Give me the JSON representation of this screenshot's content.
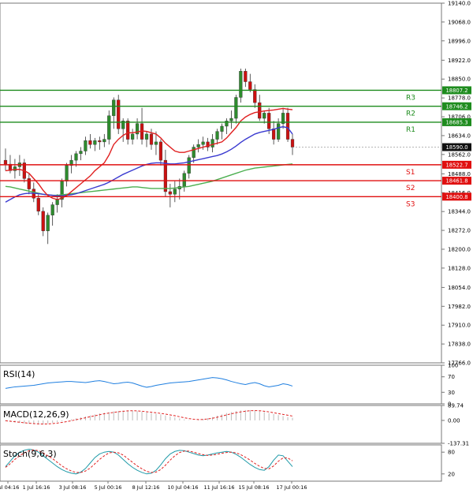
{
  "chart_data": {
    "type": "candlestick",
    "price_axis": {
      "ylim": [
        17766.0,
        19140.0
      ],
      "ticks": [
        "19140.0",
        "19068.0",
        "18996.0",
        "18922.0",
        "18850.0",
        "18778.0",
        "18706.0",
        "18634.0",
        "18562.0",
        "18488.0",
        "18416.0",
        "18344.0",
        "18272.0",
        "18200.0",
        "18128.0",
        "18054.0",
        "17982.0",
        "17910.0",
        "17838.0",
        "17766.0"
      ],
      "ticks_num": [
        19140,
        19068,
        18996,
        18922,
        18850,
        18778,
        18706,
        18634,
        18562,
        18488,
        18416,
        18344,
        18272,
        18200,
        18128,
        18054,
        17982,
        17910,
        17838,
        17766
      ]
    },
    "x_ticks": [
      "Jul 04:16",
      "1 Jul 16:16",
      "3 Jul 08:16",
      "5 Jul 00:16",
      "8 Jul 12:16",
      "10 Jul 04:16",
      "11 Jul 16:16",
      "15 Jul 08:16",
      "17 Jul 00:16"
    ],
    "current_price": "18590.0",
    "levels": [
      {
        "name": "R3",
        "value": 18807.2,
        "label": "18807.2",
        "color": "#1e8c1e"
      },
      {
        "name": "R2",
        "value": 18746.2,
        "label": "18746.2",
        "color": "#1e8c1e"
      },
      {
        "name": "R1",
        "value": 18685.3,
        "label": "18685.3",
        "color": "#1e8c1e"
      },
      {
        "name": "S1",
        "value": 18522.7,
        "label": "18522.7",
        "color": "#e01010"
      },
      {
        "name": "S2",
        "value": 18461.8,
        "label": "18461.8",
        "color": "#e01010"
      },
      {
        "name": "S3",
        "value": 18400.8,
        "label": "18400.8",
        "color": "#e01010"
      }
    ],
    "candles": [
      [
        18540,
        18585,
        18500,
        18525
      ],
      [
        18525,
        18560,
        18490,
        18500
      ],
      [
        18500,
        18545,
        18470,
        18515
      ],
      [
        18515,
        18560,
        18480,
        18530
      ],
      [
        18530,
        18545,
        18455,
        18470
      ],
      [
        18470,
        18490,
        18410,
        18430
      ],
      [
        18430,
        18455,
        18380,
        18395
      ],
      [
        18395,
        18410,
        18330,
        18345
      ],
      [
        18345,
        18360,
        18250,
        18270
      ],
      [
        18270,
        18340,
        18220,
        18330
      ],
      [
        18330,
        18380,
        18290,
        18370
      ],
      [
        18370,
        18410,
        18340,
        18390
      ],
      [
        18390,
        18470,
        18360,
        18460
      ],
      [
        18460,
        18530,
        18440,
        18520
      ],
      [
        18520,
        18560,
        18490,
        18540
      ],
      [
        18540,
        18575,
        18515,
        18565
      ],
      [
        18565,
        18590,
        18540,
        18575
      ],
      [
        18575,
        18630,
        18560,
        18615
      ],
      [
        18615,
        18640,
        18585,
        18600
      ],
      [
        18600,
        18625,
        18575,
        18615
      ],
      [
        18615,
        18630,
        18580,
        18610
      ],
      [
        18610,
        18640,
        18590,
        18620
      ],
      [
        18620,
        18730,
        18600,
        18710
      ],
      [
        18710,
        18780,
        18660,
        18770
      ],
      [
        18770,
        18790,
        18640,
        18660
      ],
      [
        18660,
        18700,
        18610,
        18690
      ],
      [
        18690,
        18700,
        18600,
        18620
      ],
      [
        18620,
        18660,
        18600,
        18640
      ],
      [
        18640,
        18700,
        18620,
        18680
      ],
      [
        18680,
        18740,
        18600,
        18620
      ],
      [
        18620,
        18650,
        18590,
        18640
      ],
      [
        18640,
        18660,
        18580,
        18600
      ],
      [
        18600,
        18650,
        18560,
        18610
      ],
      [
        18610,
        18620,
        18520,
        18540
      ],
      [
        18540,
        18580,
        18400,
        18420
      ],
      [
        18420,
        18450,
        18360,
        18410
      ],
      [
        18410,
        18460,
        18380,
        18430
      ],
      [
        18430,
        18470,
        18390,
        18440
      ],
      [
        18440,
        18500,
        18420,
        18490
      ],
      [
        18490,
        18560,
        18470,
        18550
      ],
      [
        18550,
        18600,
        18530,
        18590
      ],
      [
        18590,
        18620,
        18570,
        18600
      ],
      [
        18600,
        18630,
        18580,
        18610
      ],
      [
        18610,
        18625,
        18575,
        18590
      ],
      [
        18590,
        18640,
        18570,
        18620
      ],
      [
        18620,
        18660,
        18600,
        18650
      ],
      [
        18650,
        18680,
        18620,
        18670
      ],
      [
        18670,
        18700,
        18640,
        18690
      ],
      [
        18690,
        18730,
        18660,
        18700
      ],
      [
        18700,
        18790,
        18680,
        18780
      ],
      [
        18780,
        18890,
        18760,
        18880
      ],
      [
        18880,
        18890,
        18820,
        18840
      ],
      [
        18840,
        18870,
        18800,
        18810
      ],
      [
        18810,
        18830,
        18740,
        18760
      ],
      [
        18760,
        18790,
        18690,
        18700
      ],
      [
        18700,
        18730,
        18680,
        18720
      ],
      [
        18720,
        18740,
        18640,
        18660
      ],
      [
        18660,
        18690,
        18600,
        18620
      ],
      [
        18620,
        18700,
        18610,
        18680
      ],
      [
        18680,
        18740,
        18660,
        18720
      ],
      [
        18720,
        18740,
        18610,
        18620
      ],
      [
        18620,
        18640,
        18560,
        18590
      ]
    ],
    "ma_red": [
      18500,
      18502,
      18505,
      18505,
      18500,
      18490,
      18470,
      18450,
      18425,
      18405,
      18395,
      18390,
      18395,
      18405,
      18420,
      18435,
      18450,
      18465,
      18480,
      18500,
      18515,
      18530,
      18560,
      18600,
      18620,
      18635,
      18645,
      18645,
      18648,
      18652,
      18650,
      18645,
      18640,
      18625,
      18605,
      18590,
      18575,
      18570,
      18570,
      18575,
      18580,
      18585,
      18590,
      18595,
      18600,
      18605,
      18610,
      18625,
      18645,
      18665,
      18690,
      18705,
      18715,
      18722,
      18725,
      18728,
      18730,
      18732,
      18735,
      18738,
      18735,
      18733
    ],
    "ma_blue": [
      18380,
      18390,
      18400,
      18408,
      18412,
      18414,
      18414,
      18412,
      18410,
      18408,
      18406,
      18404,
      18404,
      18406,
      18408,
      18412,
      18418,
      18424,
      18430,
      18436,
      18442,
      18448,
      18456,
      18466,
      18476,
      18486,
      18494,
      18502,
      18510,
      18518,
      18524,
      18528,
      18530,
      18530,
      18528,
      18526,
      18526,
      18528,
      18530,
      18534,
      18538,
      18542,
      18546,
      18550,
      18554,
      18558,
      18564,
      18572,
      18582,
      18594,
      18608,
      18620,
      18630,
      18640,
      18646,
      18650,
      18654,
      18658,
      18664,
      18668,
      18664,
      18640
    ],
    "ma_green": [
      18440,
      18438,
      18434,
      18430,
      18426,
      18422,
      18418,
      18414,
      18410,
      18408,
      18406,
      18406,
      18408,
      18410,
      18412,
      18414,
      18416,
      18418,
      18420,
      18422,
      18424,
      18426,
      18428,
      18430,
      18432,
      18434,
      18436,
      18438,
      18438,
      18436,
      18434,
      18432,
      18432,
      18432,
      18432,
      18432,
      18434,
      18436,
      18438,
      18440,
      18444,
      18448,
      18452,
      18456,
      18460,
      18466,
      18472,
      18478,
      18484,
      18490,
      18496,
      18502,
      18506,
      18510,
      18512,
      18514,
      18516,
      18518,
      18520,
      18522,
      18524,
      18526
    ],
    "rsi": {
      "label": "RSI(14)",
      "ticks": [
        "100",
        "70",
        "30",
        "0"
      ],
      "ticks_num": [
        100,
        70,
        30,
        0
      ],
      "values": [
        40,
        42,
        44,
        45,
        46,
        47,
        48,
        50,
        52,
        54,
        55,
        56,
        57,
        58,
        58,
        57,
        56,
        55,
        57,
        59,
        60,
        58,
        55,
        52,
        53,
        55,
        56,
        54,
        50,
        46,
        43,
        45,
        48,
        50,
        52,
        54,
        55,
        56,
        57,
        58,
        60,
        62,
        64,
        66,
        68,
        67,
        65,
        62,
        58,
        55,
        52,
        50,
        53,
        55,
        52,
        47,
        44,
        46,
        48,
        52,
        50,
        46
      ]
    },
    "macd": {
      "label": "MACD(12,26,9)",
      "ticks": [
        "89.74",
        "0.00",
        "-137.31"
      ],
      "ticks_num": [
        89.74,
        0,
        -137.31
      ],
      "hist": [
        -5,
        -8,
        -12,
        -15,
        -18,
        -20,
        -22,
        -24,
        -22,
        -18,
        -14,
        -10,
        -5,
        0,
        6,
        12,
        18,
        24,
        30,
        36,
        42,
        46,
        50,
        54,
        56,
        58,
        60,
        58,
        55,
        52,
        48,
        44,
        40,
        36,
        30,
        24,
        18,
        12,
        6,
        2,
        0,
        4,
        8,
        14,
        20,
        28,
        36,
        44,
        50,
        56,
        60,
        62,
        62,
        60,
        56,
        50,
        44,
        38,
        32,
        26,
        20,
        16
      ],
      "signal": [
        -2,
        -5,
        -8,
        -11,
        -14,
        -17,
        -19,
        -21,
        -22,
        -21,
        -19,
        -16,
        -12,
        -7,
        -2,
        4,
        10,
        16,
        22,
        28,
        34,
        40,
        44,
        48,
        52,
        55,
        57,
        58,
        57,
        55,
        52,
        49,
        46,
        42,
        38,
        33,
        28,
        22,
        16,
        11,
        7,
        5,
        6,
        9,
        13,
        19,
        26,
        33,
        40,
        46,
        51,
        55,
        58,
        59,
        58,
        55,
        51,
        46,
        41,
        36,
        31,
        26
      ]
    },
    "stoch": {
      "label": "Stoch(9,6,3)",
      "ticks": [
        "80",
        "20"
      ],
      "ticks_num": [
        80,
        20
      ],
      "k": [
        40,
        55,
        70,
        80,
        85,
        88,
        86,
        80,
        70,
        60,
        50,
        40,
        32,
        26,
        22,
        20,
        25,
        35,
        50,
        65,
        75,
        80,
        82,
        80,
        72,
        60,
        48,
        38,
        30,
        24,
        20,
        22,
        30,
        45,
        62,
        75,
        82,
        85,
        84,
        80,
        76,
        72,
        70,
        72,
        75,
        78,
        80,
        82,
        80,
        74,
        66,
        56,
        46,
        38,
        32,
        30,
        40,
        58,
        72,
        70,
        55,
        40
      ],
      "d": [
        38,
        48,
        60,
        70,
        78,
        84,
        86,
        84,
        78,
        70,
        62,
        52,
        42,
        34,
        28,
        24,
        24,
        28,
        36,
        48,
        60,
        70,
        78,
        80,
        78,
        72,
        62,
        52,
        42,
        34,
        27,
        24,
        25,
        32,
        44,
        58,
        70,
        79,
        83,
        83,
        80,
        76,
        73,
        71,
        72,
        74,
        77,
        79,
        80,
        78,
        73,
        66,
        58,
        49,
        41,
        35,
        34,
        42,
        55,
        64,
        64,
        56
      ]
    }
  }
}
